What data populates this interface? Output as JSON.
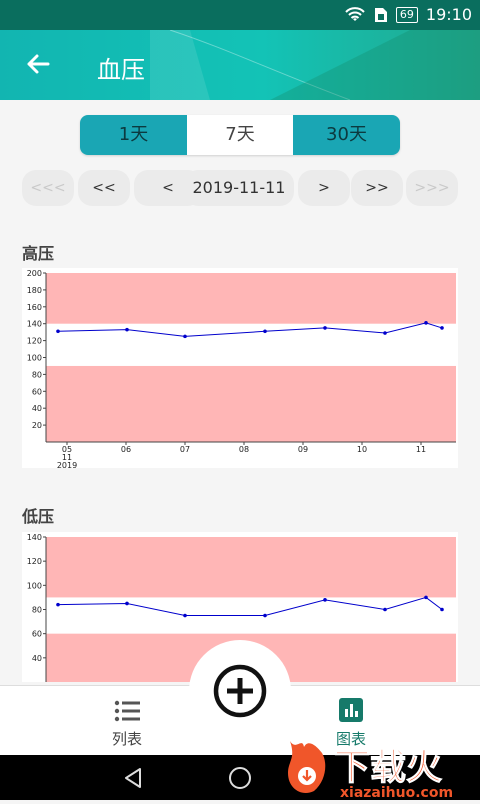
{
  "status_bar": {
    "battery": "69",
    "time": "19:10"
  },
  "header": {
    "title": "血压"
  },
  "range_tabs": [
    {
      "label": "1天",
      "selected": false
    },
    {
      "label": "7天",
      "selected": true
    },
    {
      "label": "30天",
      "selected": false
    }
  ],
  "date_nav": {
    "first": "<<<",
    "prev_big": "<<",
    "prev": "<",
    "date": "2019-11-11",
    "next": ">",
    "next_big": ">>",
    "last": ">>>"
  },
  "charts": {
    "high": {
      "title": "高压"
    },
    "low": {
      "title": "低压"
    }
  },
  "chart_data": [
    {
      "type": "line",
      "title": "高压",
      "x_tick_labels": [
        "05\n11\n2019",
        "06",
        "07",
        "08",
        "09",
        "10",
        "11"
      ],
      "ylim": [
        0,
        200
      ],
      "y_ticks": [
        20,
        40,
        60,
        80,
        100,
        120,
        140,
        160,
        180,
        200
      ],
      "bands": [
        [
          140,
          200
        ],
        [
          0,
          90
        ]
      ],
      "band_color": "#ffb6b6",
      "line_color": "#0000cc",
      "x": [
        "05 11",
        "06 06",
        "07 00",
        "08 08",
        "09 10",
        "10 08",
        "11 02",
        "11 08"
      ],
      "values": [
        131,
        133,
        125,
        131,
        135,
        129,
        141,
        135
      ]
    },
    {
      "type": "line",
      "title": "低压",
      "ylim": [
        20,
        140
      ],
      "y_ticks": [
        40,
        60,
        80,
        100,
        120,
        140
      ],
      "bands": [
        [
          90,
          140
        ],
        [
          20,
          60
        ]
      ],
      "band_color": "#ffb6b6",
      "line_color": "#0000cc",
      "x": [
        "05 11",
        "06 06",
        "07 00",
        "08 08",
        "09 10",
        "10 08",
        "11 02",
        "11 08"
      ],
      "values": [
        84,
        85,
        75,
        75,
        88,
        80,
        90,
        80
      ]
    }
  ],
  "bottom_nav": {
    "list_label": "列表",
    "chart_label": "图表"
  },
  "watermark": {
    "title": "下载火",
    "url": "xiazaihuo.com"
  }
}
